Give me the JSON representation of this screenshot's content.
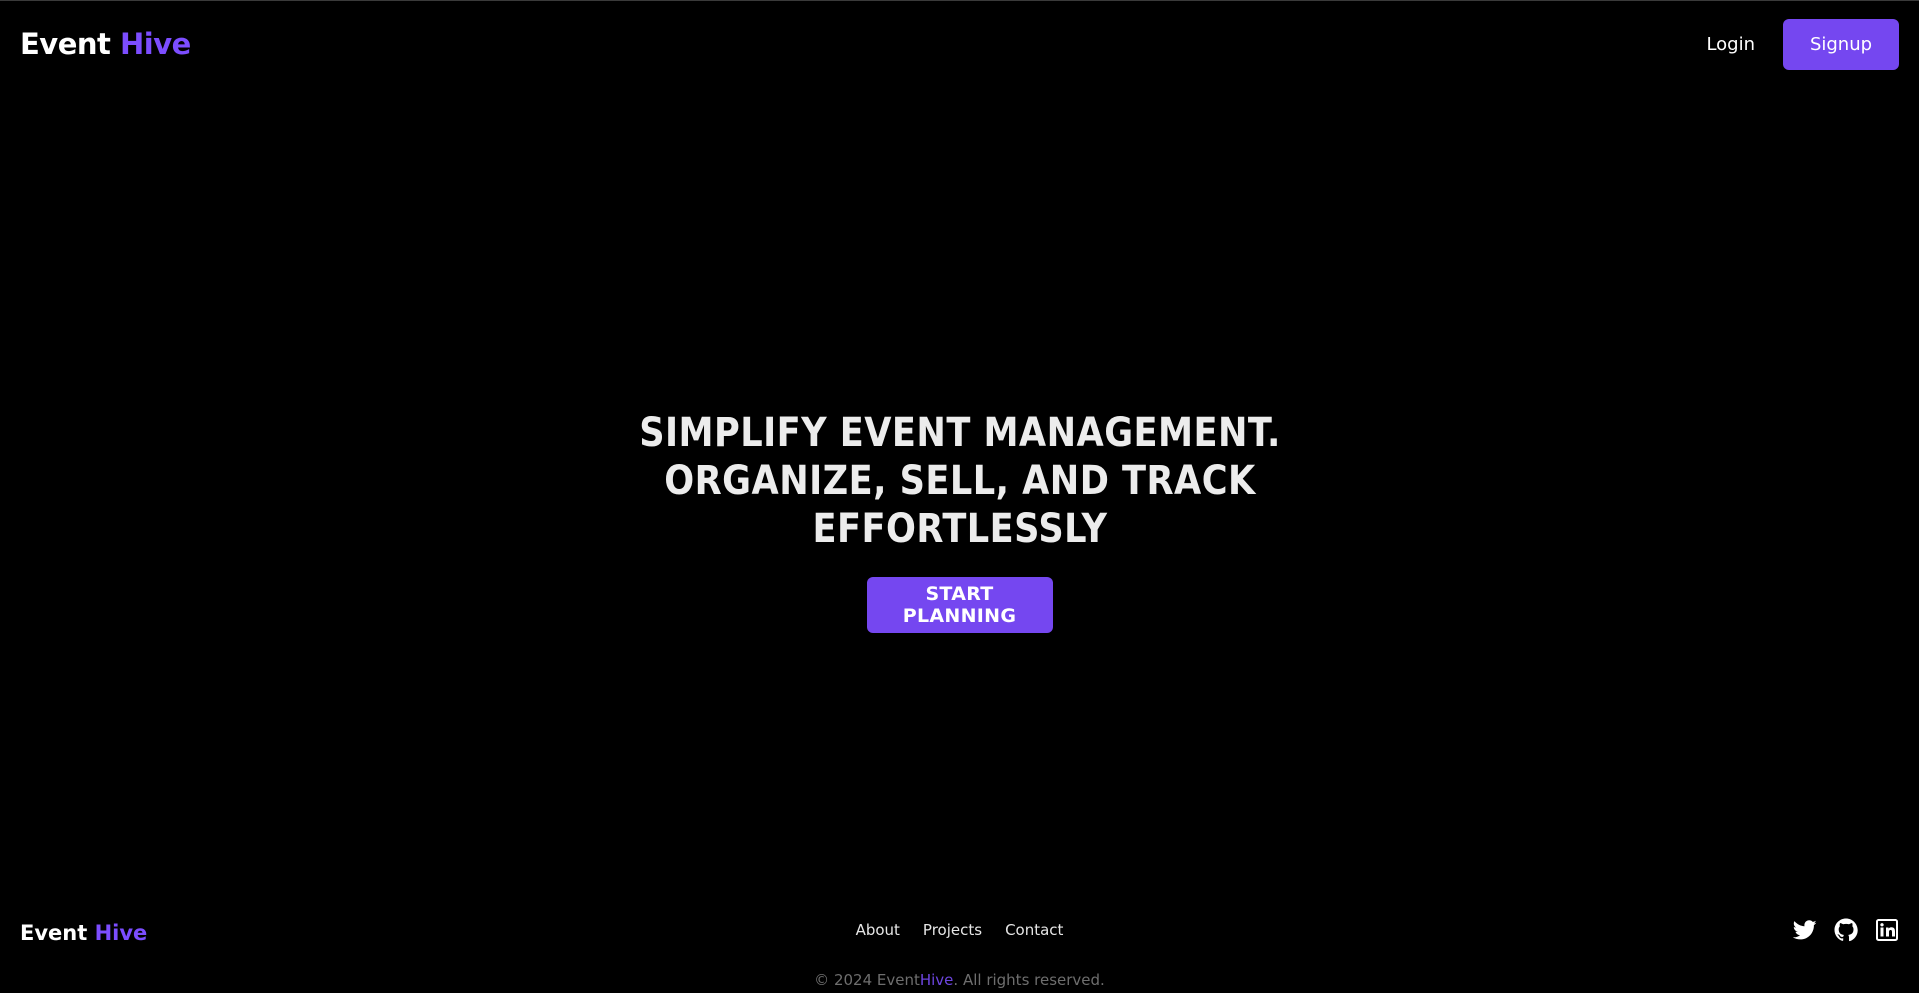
{
  "brand": {
    "name_part1": "Event",
    "name_part2": "Hive",
    "accent_color": "#7547f0"
  },
  "header": {
    "login_label": "Login",
    "signup_label": "Signup"
  },
  "hero": {
    "title": "Simplify Event Management. Organize, Sell, and Track Effortlessly",
    "cta_label": "Start Planning"
  },
  "footer": {
    "links": [
      "About",
      "Projects",
      "Contact"
    ],
    "social_icons": [
      "twitter-icon",
      "github-icon",
      "linkedin-icon"
    ],
    "copyright_prefix": "© 2024 Event",
    "copyright_brand": "Hive",
    "copyright_suffix": ". All rights reserved."
  }
}
